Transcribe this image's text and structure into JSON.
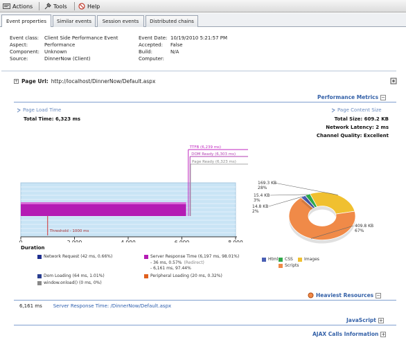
{
  "toolbar": {
    "actions": "Actions",
    "tools": "Tools",
    "help": "Help"
  },
  "tabs": [
    "Event properties",
    "Similar events",
    "Session events",
    "Distributed chains"
  ],
  "props": {
    "event_class_label": "Event class:",
    "event_class": "Client Side Performance Event",
    "aspect_label": "Aspect:",
    "aspect": "Performance",
    "component_label": "Component:",
    "component": "Unknown",
    "source_label": "Source:",
    "source": "DinnerNow (Client)",
    "event_date_label": "Event Date:",
    "event_date": "10/19/2010 5:21:57 PM",
    "accepted_label": "Accepted:",
    "accepted": "False",
    "build_label": "Build:",
    "build": "N/A",
    "computer_label": "Computer:",
    "computer": ""
  },
  "page_url": {
    "label": "Page Url:",
    "value": "http://localhost/DinnerNow/Default.aspx"
  },
  "performance": {
    "header": "Performance Metrics",
    "load_time_label": "Page Load Time",
    "total_time": "Total Time: 6,323 ms",
    "content_size_label": "Page Content Size",
    "total_size": "Total Size: 609.2 KB",
    "network_latency": "Network Latency: 2 ms",
    "channel_quality": "Channel Quality: Excellent"
  },
  "chart_data": [
    {
      "type": "bar",
      "orientation": "horizontal",
      "x": [
        0,
        2000,
        4000,
        6000,
        8000
      ],
      "xlim": [
        0,
        8000
      ],
      "tick_labels": [
        "0",
        "2,000",
        "4,000",
        "6,000",
        "8,000"
      ],
      "xlabel": "Duration",
      "series": [
        {
          "name": "Server Response Time",
          "values": [
            6157
          ]
        }
      ],
      "threshold": {
        "label": "Threshold - 1000 ms",
        "value": 1000
      },
      "markers": [
        {
          "label": "TTFB (6,239 ms)",
          "value": 6239,
          "color": "#c026c0"
        },
        {
          "label": "DOM Ready (6,303 ms)",
          "value": 6303,
          "color": "#b03cb0"
        },
        {
          "label": "Page Ready (6,323 ms)",
          "value": 6323,
          "color": "#aaaaaa"
        }
      ],
      "legend": [
        {
          "label": "Network Request (42 ms, 0.66%)",
          "color": "#1f2f8f"
        },
        {
          "label": "Server Response Time (6,197 ms, 98.01%)",
          "color": "#b41cb4"
        },
        {
          "label": "- 36 ms, 0.57%",
          "color": ""
        },
        {
          "label": "(Redirect)",
          "color": ""
        },
        {
          "label": "- 6,161 ms, 97.44%",
          "color": ""
        },
        {
          "label": "Dom Loading (64 ms, 1.01%)",
          "color": "#2a3f8f"
        },
        {
          "label": "Peripheral Loading (20 ms, 0.32%)",
          "color": "#e0601e"
        },
        {
          "label": "window.onload() (0 ms, 0%)",
          "color": "#888888"
        }
      ]
    },
    {
      "type": "pie",
      "variant": "donut",
      "slices": [
        {
          "name": "Html",
          "value": 14.8,
          "label": "14.8 KB",
          "percent": "2%",
          "color": "#4a5fb4"
        },
        {
          "name": "CSS",
          "value": 15.4,
          "label": "15.4 KB",
          "percent": "3%",
          "color": "#2fa84a"
        },
        {
          "name": "Images",
          "value": 169.3,
          "label": "169.3 KB",
          "percent": "28%",
          "color": "#f0c030"
        },
        {
          "name": "Scripts",
          "value": 409.8,
          "label": "409.8 KB",
          "percent": "67%",
          "color": "#f08a48"
        }
      ],
      "legend": [
        "Html",
        "CSS",
        "Images",
        "Scripts"
      ]
    }
  ],
  "heaviest": {
    "header": "Heaviest Resources",
    "row_time": "6,161 ms",
    "row_link": "Server Response Time: /DinnerNow/Default.aspx"
  },
  "javascript": {
    "header": "JavaScript"
  },
  "ajax": {
    "header": "AJAX Calls Information"
  }
}
